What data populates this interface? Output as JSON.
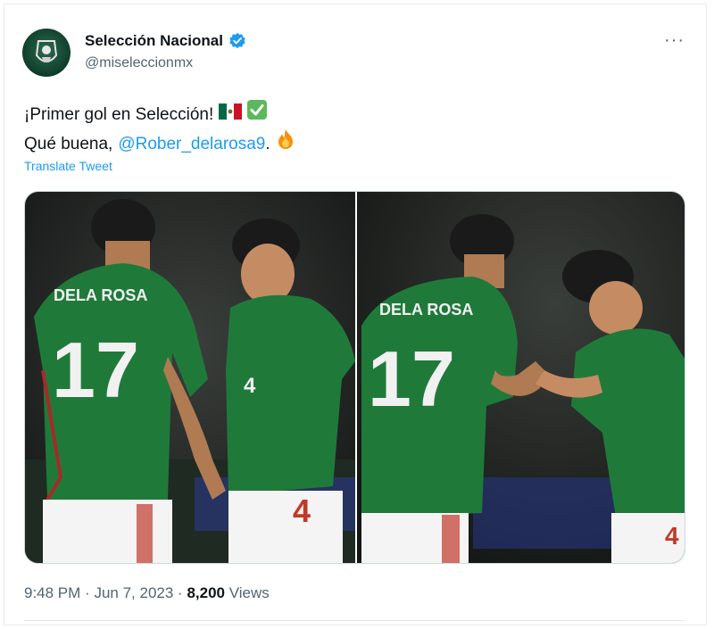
{
  "tweet": {
    "author_name": "Selección Nacional",
    "author_handle": "@miseleccionmx",
    "more_label": "···",
    "text_line1": "¡Primer gol en Selección!",
    "text_line2_prefix": "Qué buena,",
    "mention": "@Rober_delarosa9",
    "text_line2_suffix": ".",
    "translate_label": "Translate Tweet",
    "time": "9:48 PM",
    "date": "Jun 7, 2023",
    "views_count": "8,200",
    "views_label": "Views",
    "separator": "·"
  },
  "media": {
    "photo1": {
      "jersey_name": "DELA ROSA",
      "number_back": "17",
      "number_front": "4"
    },
    "photo2": {
      "jersey_name": "DELA ROSA",
      "number_back": "17",
      "number_front": "4"
    }
  },
  "icons": {
    "verified": "verified-badge-icon",
    "mexico_flag": "mexico-flag-icon",
    "check": "check-mark-icon",
    "fire": "fire-icon",
    "more": "more-options-icon"
  },
  "colors": {
    "accent": "#1d9bf0",
    "text_primary": "#0f1419",
    "text_secondary": "#536471",
    "avatar_bg": "#0e3d2a",
    "jersey_green": "#1f7a3a"
  }
}
